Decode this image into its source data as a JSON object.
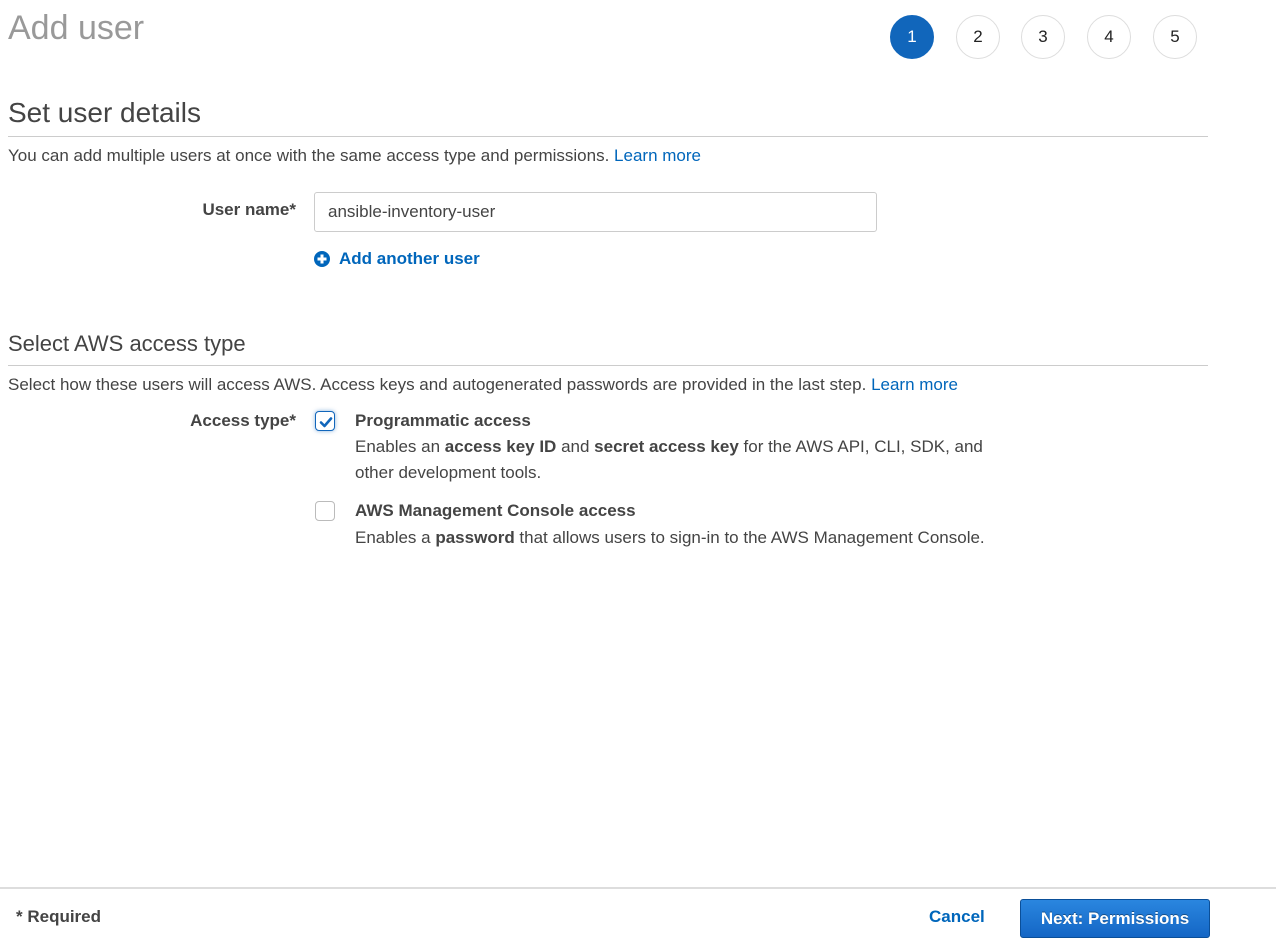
{
  "page": {
    "title": "Add user"
  },
  "wizard": {
    "steps": [
      {
        "label": "1",
        "active": true
      },
      {
        "label": "2",
        "active": false
      },
      {
        "label": "3",
        "active": false
      },
      {
        "label": "4",
        "active": false
      },
      {
        "label": "5",
        "active": false
      }
    ]
  },
  "user_details": {
    "title": "Set user details",
    "description": "You can add multiple users at once with the same access type and permissions.",
    "learn_more": "Learn more",
    "username_label": "User name*",
    "username_value": "ansible-inventory-user",
    "add_another_user": "Add another user"
  },
  "access_type": {
    "title": "Select AWS access type",
    "description": "Select how these users will access AWS. Access keys and autogenerated passwords are provided in the last step.",
    "learn_more": "Learn more",
    "label": "Access type*",
    "options": [
      {
        "title": "Programmatic access",
        "checked": true,
        "desc_parts": [
          "Enables an ",
          "access key ID",
          " and ",
          "secret access key",
          " for the AWS API, CLI, SDK, and other development tools."
        ]
      },
      {
        "title": "AWS Management Console access",
        "checked": false,
        "desc_parts": [
          "Enables a ",
          "password",
          " that allows users to sign-in to the AWS Management Console."
        ]
      }
    ]
  },
  "footer": {
    "required_note": "* Required",
    "cancel_label": "Cancel",
    "next_label": "Next: Permissions"
  },
  "colors": {
    "accent": "#1166bb",
    "link": "#0066bb"
  }
}
